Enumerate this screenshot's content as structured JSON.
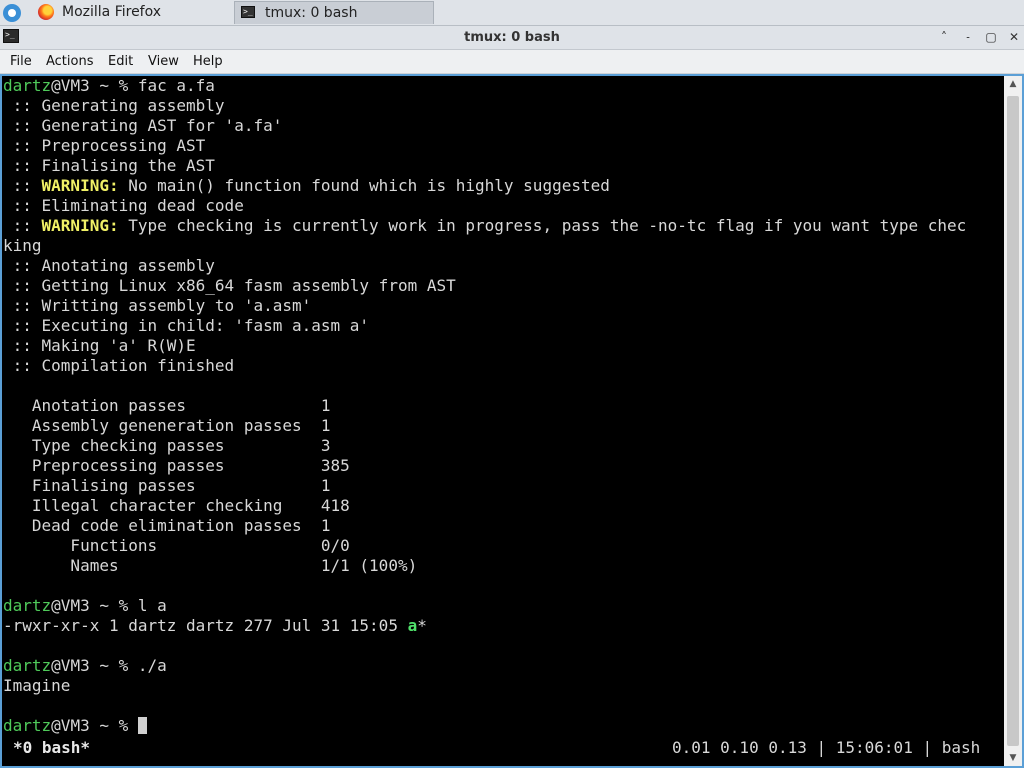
{
  "taskbar": {
    "tasks": [
      {
        "icon": "firefox-icon",
        "label": "Mozilla Firefox"
      },
      {
        "icon": "terminal-icon",
        "label": "tmux: 0 bash"
      }
    ]
  },
  "window": {
    "title": "tmux: 0 bash",
    "controls": [
      "keep-above",
      "minimize",
      "maximize",
      "close"
    ]
  },
  "menu": [
    "File",
    "Actions",
    "Edit",
    "View",
    "Help"
  ],
  "terminal": {
    "prompt": {
      "user": "dartz",
      "rest": "@VM3 ~ % "
    },
    "lines": [
      {
        "cmd": "fac a.fa"
      },
      {
        "text": " :: Generating assembly"
      },
      {
        "text": " :: Generating AST for 'a.fa'"
      },
      {
        "text": " :: Preprocessing AST"
      },
      {
        "text": " :: Finalising the AST"
      },
      {
        "pre": " :: ",
        "warn": "WARNING:",
        "post": " No main() function found which is highly suggested"
      },
      {
        "text": " :: Eliminating dead code"
      },
      {
        "pre": " :: ",
        "warn": "WARNING:",
        "post": " Type checking is currently work in progress, pass the -no-tc flag if you want type chec"
      },
      {
        "text": "king"
      },
      {
        "text": " :: Anotating assembly"
      },
      {
        "text": " :: Getting Linux x86_64 fasm assembly from AST"
      },
      {
        "text": " :: Writting assembly to 'a.asm'"
      },
      {
        "text": " :: Executing in child: 'fasm a.asm a'"
      },
      {
        "text": " :: Making 'a' R(W)E"
      },
      {
        "text": " :: Compilation finished"
      },
      {
        "text": ""
      },
      {
        "text": "   Anotation passes              1"
      },
      {
        "text": "   Assembly geneneration passes  1"
      },
      {
        "text": "   Type checking passes          3"
      },
      {
        "text": "   Preprocessing passes          385"
      },
      {
        "text": "   Finalising passes             1"
      },
      {
        "text": "   Illegal character checking    418"
      },
      {
        "text": "   Dead code elimination passes  1"
      },
      {
        "text": "       Functions                 0/0"
      },
      {
        "text": "       Names                     1/1 (100%)"
      },
      {
        "text": ""
      },
      {
        "cmd": "l a"
      },
      {
        "text": "-rwxr-xr-x 1 dartz dartz 277 Jul 31 15:05 ",
        "exec": "a",
        "suffix": "*"
      },
      {
        "text": ""
      },
      {
        "cmd": "./a"
      },
      {
        "text": "Imagine"
      },
      {
        "text": ""
      },
      {
        "cmd": "",
        "cursor": true
      }
    ]
  },
  "status": {
    "left": "*0 bash*",
    "right": "0.01 0.10 0.13 | 15:06:01 | bash"
  },
  "colors": {
    "prompt_user": "#4fca5a",
    "warning": "#f0f066",
    "executable": "#4fe06a",
    "terminal_bg": "#000000",
    "terminal_fg": "#d8d8d8"
  }
}
